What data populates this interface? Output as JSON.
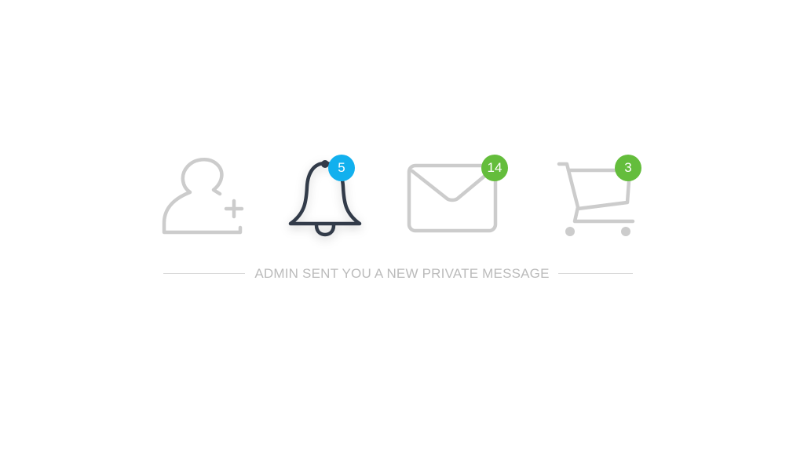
{
  "colors": {
    "icon_idle": "#cccccc",
    "icon_active": "#333b49",
    "badge_blue": "#12b0ee",
    "badge_green": "#64bd3c",
    "divider": "#d9d9d9",
    "message_text": "#bbbbbb"
  },
  "icons": {
    "add_user": {
      "icon": "add-user-icon",
      "active": false
    },
    "notifications": {
      "icon": "bell-icon",
      "active": true,
      "badge": "5"
    },
    "messages": {
      "icon": "envelope-icon",
      "active": false,
      "badge": "14"
    },
    "cart": {
      "icon": "shopping-cart-icon",
      "active": false,
      "badge": "3"
    }
  },
  "message": {
    "text": "ADMIN SENT YOU A NEW PRIVATE MESSAGE"
  }
}
